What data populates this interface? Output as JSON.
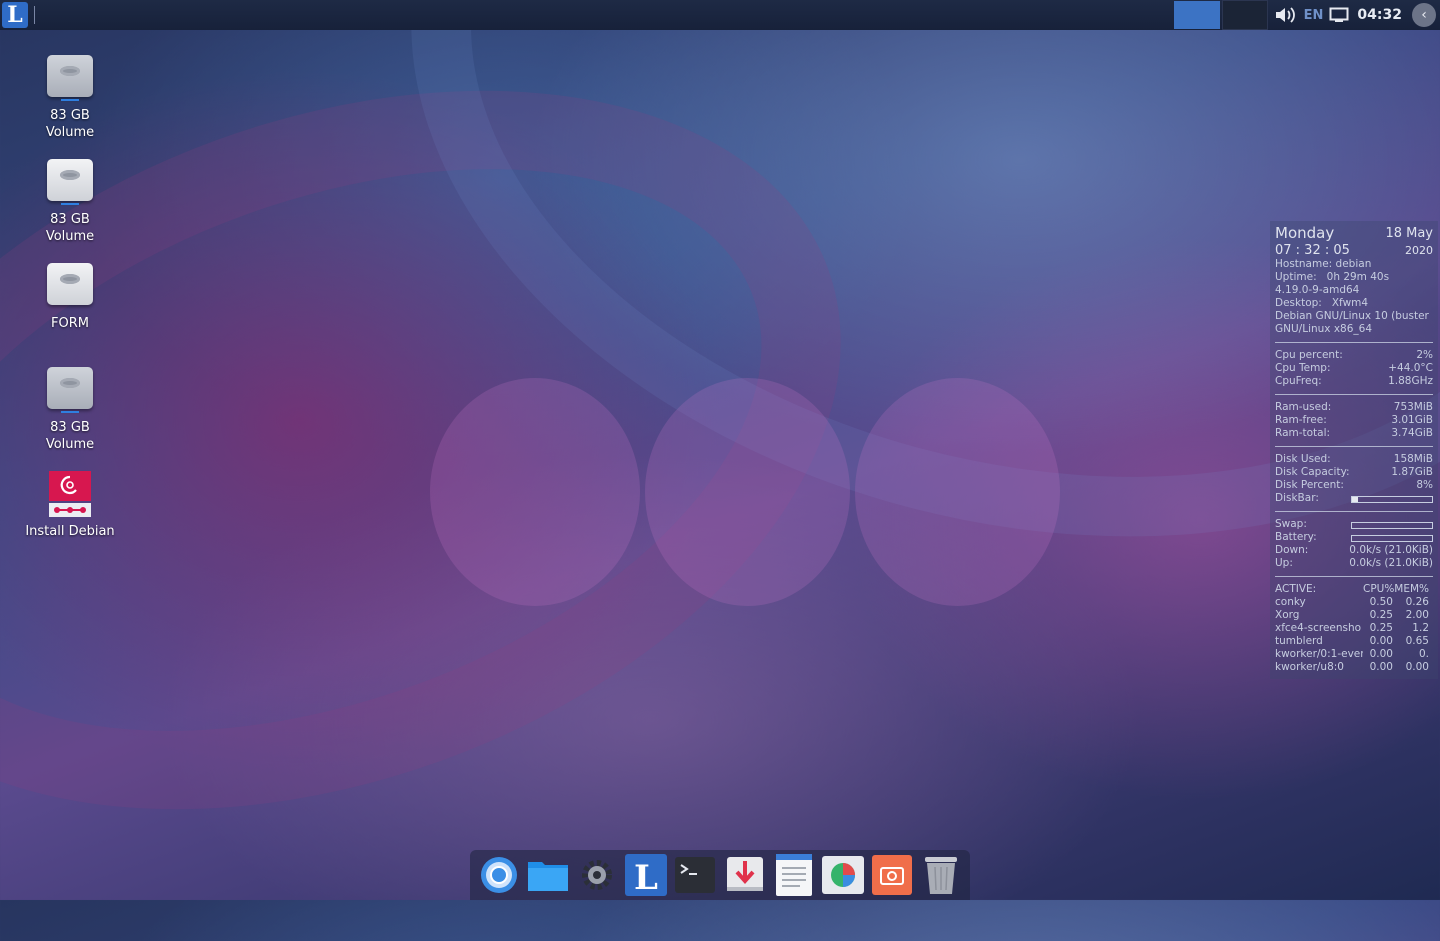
{
  "panel": {
    "app_logo_letter": "L",
    "language": "EN",
    "clock": "04:32"
  },
  "desktop_icons": [
    {
      "line1": "83 GB",
      "line2": "Volume"
    },
    {
      "line1": "83 GB",
      "line2": "Volume"
    },
    {
      "line1": "FORM",
      "line2": ""
    },
    {
      "line1": "83 GB",
      "line2": "Volume"
    },
    {
      "line1": "Install Debian",
      "line2": ""
    }
  ],
  "conky": {
    "day": "Monday",
    "date": "18 May",
    "time": "07 : 32 : 05",
    "year": "2020",
    "hostname": "Hostname: debian",
    "uptime_label": "Uptime:",
    "uptime": "0h 29m 40s",
    "kernel": "4.19.0-9-amd64",
    "desktop_label": "Desktop:",
    "desktop": "Xfwm4",
    "os": "Debian GNU/Linux 10 (buster",
    "arch": "GNU/Linux x86_64",
    "cpu_percent_label": "Cpu percent:",
    "cpu_percent": "2%",
    "cpu_temp_label": "Cpu Temp:",
    "cpu_temp": "+44.0°C",
    "cpu_freq_label": "CpuFreq:",
    "cpu_freq": "1.88GHz",
    "ram_used_label": "Ram-used:",
    "ram_used": "753MiB",
    "ram_free_label": "Ram-free:",
    "ram_free": "3.01GiB",
    "ram_total_label": "Ram-total:",
    "ram_total": "3.74GiB",
    "disk_used_label": "Disk Used:",
    "disk_used": "158MiB",
    "disk_capacity_label": "Disk Capacity:",
    "disk_capacity": "1.87GiB",
    "disk_percent_label": "Disk Percent:",
    "disk_percent": "8%",
    "diskbar_label": "DiskBar:",
    "diskbar_fraction": 0.08,
    "swap_label": "Swap:",
    "swap_fraction": 0.0,
    "battery_label": "Battery:",
    "battery_fraction": 0.0,
    "down_label": "Down:",
    "down": "0.0k/s (21.0KiB)",
    "up_label": "Up:",
    "up": "0.0k/s (21.0KiB)",
    "proc_header": {
      "name": "ACTIVE:",
      "cpu": "CPU%",
      "mem": "MEM%"
    },
    "processes": [
      {
        "name": "conky",
        "cpu": "0.50",
        "mem": "0.26"
      },
      {
        "name": "Xorg",
        "cpu": "0.25",
        "mem": "2.00"
      },
      {
        "name": "xfce4-screensho",
        "cpu": "0.25",
        "mem": "1.2"
      },
      {
        "name": "tumblerd",
        "cpu": "0.00",
        "mem": "0.65"
      },
      {
        "name": "kworker/0:1-even",
        "cpu": "0.00",
        "mem": "0."
      },
      {
        "name": "kworker/u8:0",
        "cpu": "0.00",
        "mem": "0.00"
      }
    ]
  },
  "dock_icons": [
    "chromium-icon",
    "files-icon",
    "settings-icon",
    "launcher-icon",
    "terminal-icon",
    "installer-icon",
    "text-editor-icon",
    "disk-utility-icon",
    "screenshot-icon",
    "trash-icon"
  ]
}
